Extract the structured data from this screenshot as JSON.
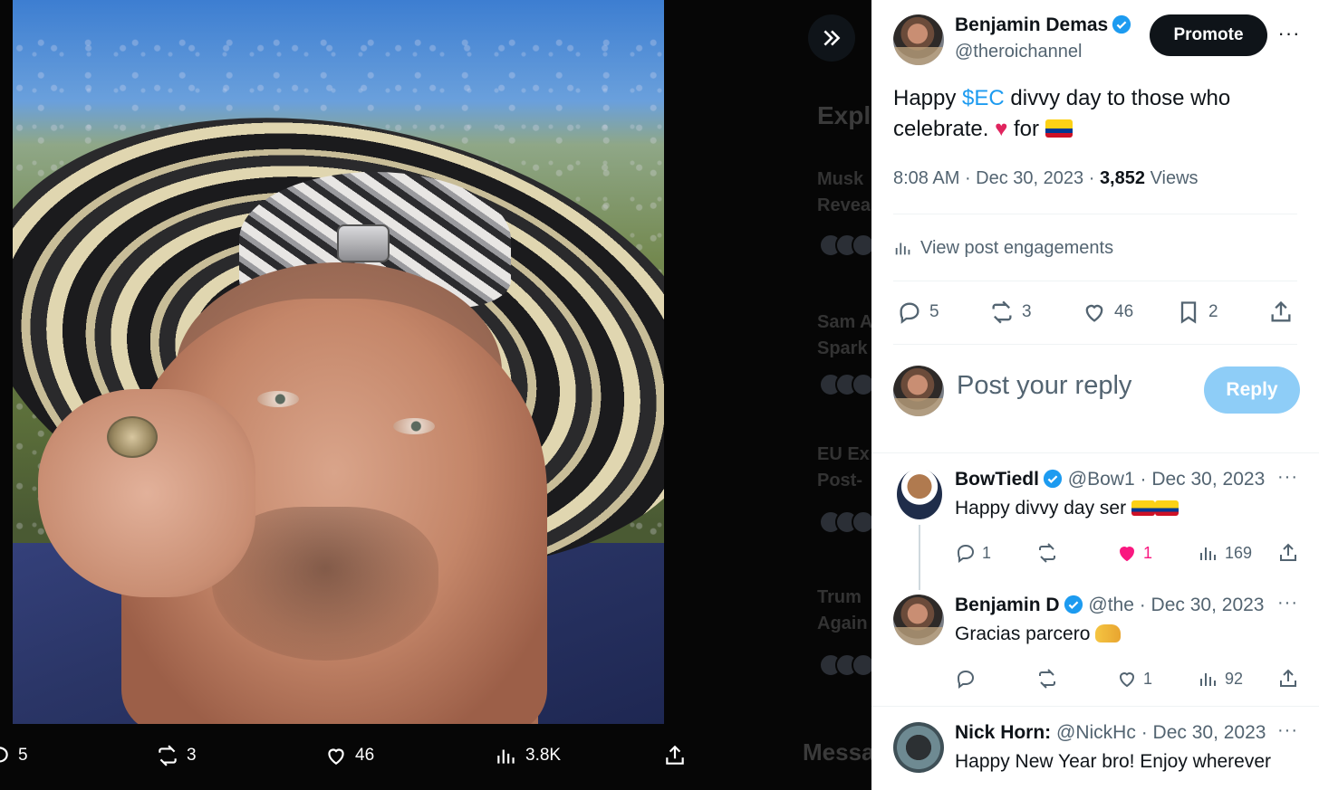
{
  "viewer": {
    "actions": {
      "replies": "5",
      "reposts": "3",
      "likes": "46",
      "views": "3.8K"
    },
    "background": {
      "explore_header": "Expl",
      "trends": [
        "Musk",
        "Revea",
        "Sam A",
        "Spark",
        "EU Ex",
        "Post-",
        "Trum",
        "Again"
      ],
      "messages": "Messa"
    }
  },
  "post": {
    "author_name": "Benjamin Demas",
    "author_handle": "@theroichannel",
    "promote_label": "Promote",
    "more_icon": "···",
    "text_pre": "Happy ",
    "cashtag": "$EC",
    "text_mid": " divvy day to those who celebrate. ",
    "heart": "♥",
    "text_for": " for ",
    "time": "8:08 AM",
    "date": "Dec 30, 2023",
    "views_count": "3,852",
    "views_label": "Views",
    "engagements_label": "View post engagements",
    "actions": {
      "replies": "5",
      "reposts": "3",
      "likes": "46",
      "bookmarks": "2"
    }
  },
  "composer": {
    "placeholder": "Post your reply",
    "reply_label": "Reply"
  },
  "replies": [
    {
      "name": "BowTiedl",
      "handle": "@Bow1",
      "date": "· Dec 30, 2023",
      "text": "Happy divvy day ser",
      "replies": "1",
      "likes": "1",
      "views": "169"
    },
    {
      "name": "Benjamin D",
      "handle": "@the",
      "date": "· Dec 30, 2023",
      "text": "Gracias parcero",
      "replies": "",
      "likes": "1",
      "views": "92"
    },
    {
      "name": "Nick Horn:",
      "handle": "@NickHc",
      "date": "· Dec 30, 2023",
      "text": "Happy New Year bro! Enjoy wherever"
    }
  ],
  "colors": {
    "accent": "#1d9bf0",
    "like": "#f91880",
    "reply_button": "#8ecdf7"
  }
}
